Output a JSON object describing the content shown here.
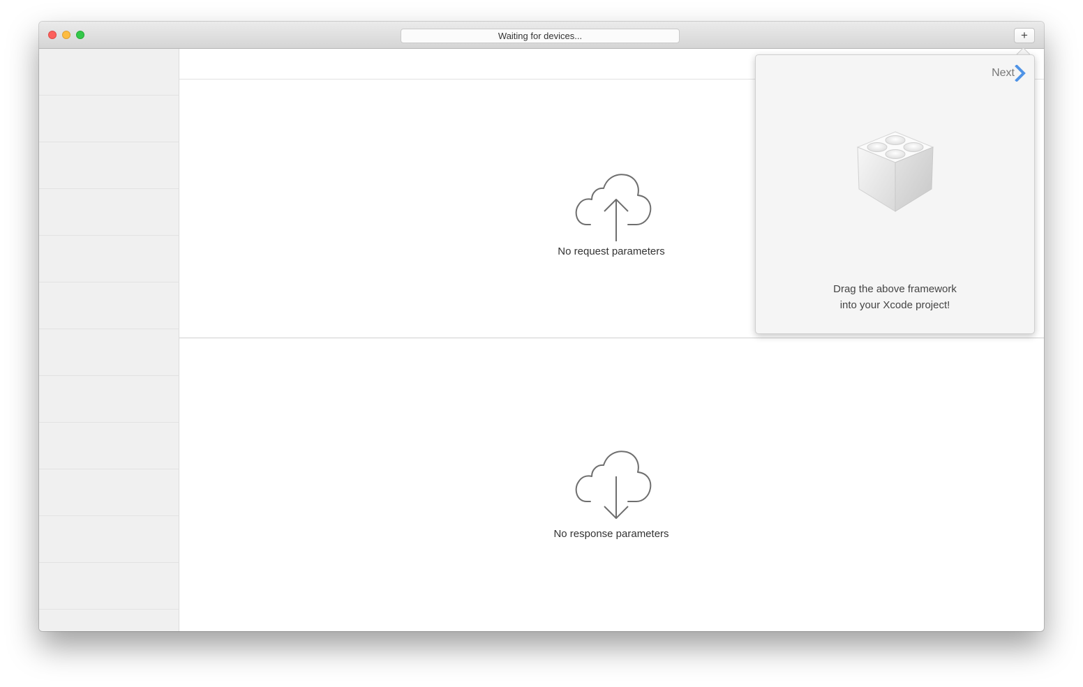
{
  "window": {
    "status_text": "Waiting for devices...",
    "add_button_label": "+"
  },
  "request": {
    "empty_text": "No request parameters"
  },
  "response": {
    "empty_text": "No response parameters"
  },
  "popover": {
    "next_label": "Next",
    "message_line1": "Drag the above framework",
    "message_line2": "into your Xcode project!"
  },
  "icons": {
    "request": "cloud-upload-icon",
    "response": "cloud-download-icon",
    "framework": "framework-brick-icon",
    "next": "chevron-right-icon"
  },
  "colors": {
    "next_chevron": "#4f93e6",
    "close": "#fc605c",
    "minimize": "#fdbc40",
    "zoom": "#34c84a"
  }
}
